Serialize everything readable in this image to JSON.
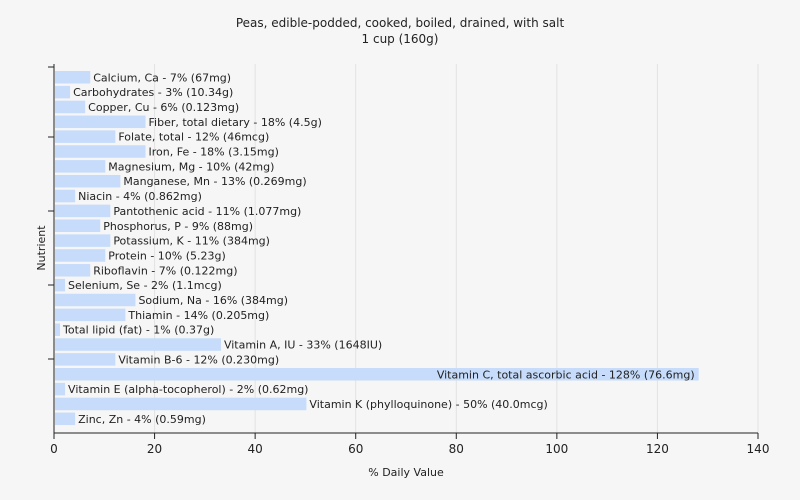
{
  "chart_data": {
    "type": "bar",
    "orientation": "horizontal",
    "title": "Peas, edible-podded, cooked, boiled, drained, with salt",
    "subtitle": "1 cup (160g)",
    "xlabel": "% Daily Value",
    "ylabel": "Nutrient",
    "xlim": [
      0,
      140
    ],
    "xticks": [
      0,
      20,
      40,
      60,
      80,
      100,
      120,
      140
    ],
    "xtick_labels": [
      "0",
      "20",
      "40",
      "60",
      "80",
      "100",
      "120",
      "140"
    ],
    "grid": "vertical",
    "bar_color": "#c6dcfa",
    "categories": [
      "Calcium, Ca - 7% (67mg)",
      "Carbohydrates - 3% (10.34g)",
      "Copper, Cu - 6% (0.123mg)",
      "Fiber, total dietary - 18% (4.5g)",
      "Folate, total - 12% (46mcg)",
      "Iron, Fe - 18% (3.15mg)",
      "Magnesium, Mg - 10% (42mg)",
      "Manganese, Mn - 13% (0.269mg)",
      "Niacin - 4% (0.862mg)",
      "Pantothenic acid - 11% (1.077mg)",
      "Phosphorus, P - 9% (88mg)",
      "Potassium, K - 11% (384mg)",
      "Protein - 10% (5.23g)",
      "Riboflavin - 7% (0.122mg)",
      "Selenium, Se - 2% (1.1mcg)",
      "Sodium, Na - 16% (384mg)",
      "Thiamin - 14% (0.205mg)",
      "Total lipid (fat) - 1% (0.37g)",
      "Vitamin A, IU - 33% (1648IU)",
      "Vitamin B-6 - 12% (0.230mg)",
      "Vitamin C, total ascorbic acid - 128% (76.6mg)",
      "Vitamin E (alpha-tocopherol) - 2% (0.62mg)",
      "Vitamin K (phylloquinone) - 50% (40.0mcg)",
      "Zinc, Zn - 4% (0.59mg)"
    ],
    "values": [
      7,
      3,
      6,
      18,
      12,
      18,
      10,
      13,
      4,
      11,
      9,
      11,
      10,
      7,
      2,
      16,
      14,
      1,
      33,
      12,
      128,
      2,
      50,
      4
    ]
  }
}
